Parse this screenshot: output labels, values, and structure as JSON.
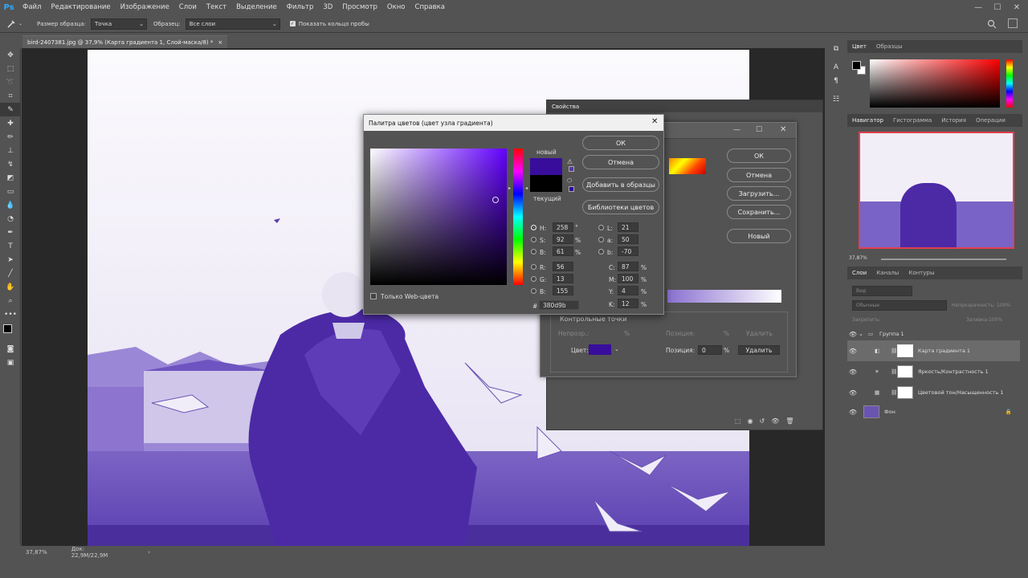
{
  "app": {
    "logo": "Ps",
    "menu": [
      "Файл",
      "Редактирование",
      "Изображение",
      "Слои",
      "Текст",
      "Выделение",
      "Фильтр",
      "3D",
      "Просмотр",
      "Окно",
      "Справка"
    ]
  },
  "window": {
    "minimize": "—",
    "maximize": "☐",
    "close": "✕"
  },
  "options": {
    "sample_size_label": "Размер образца:",
    "sample_size_value": "Точка",
    "sample_label": "Образец:",
    "sample_value": "Все слои",
    "show_ring_label": "Показать кольцо пробы"
  },
  "document": {
    "tab_title": "bird-2407381.jpg @ 37,9% (Карта градиента 1, Слой-маска/8) *",
    "tab_close": "×",
    "zoom": "37,87%",
    "doc_size": "Док: 22,9M/22,9M"
  },
  "color_panel": {
    "tabs": [
      "Цвет",
      "Образцы"
    ]
  },
  "navigator": {
    "tabs": [
      "Навигатор",
      "Гистограмма",
      "История",
      "Операции"
    ],
    "zoom": "37,87%"
  },
  "layers_panel": {
    "tabs": [
      "Слои",
      "Каналы",
      "Контуры"
    ],
    "kind_placeholder": "Вид",
    "blend_mode": "Обычные",
    "opacity_label": "Непрозрачность:",
    "opacity_value": "100%",
    "lock_label": "Закрепить:",
    "fill_label": "Заливка:",
    "fill_value": "100%",
    "layers": [
      {
        "name": "Группа 1"
      },
      {
        "name": "Карта градиента 1"
      },
      {
        "name": "Яркость/Контрастность 1"
      },
      {
        "name": "Цветовой тон/Насыщенность 1"
      },
      {
        "name": "Фон"
      }
    ]
  },
  "properties": {
    "title": "Свойства"
  },
  "gradient_editor": {
    "ok": "ОК",
    "cancel": "Отмена",
    "load": "Загрузить...",
    "save": "Сохранить...",
    "new": "Новый",
    "stops_label": "Контрольные точки",
    "opacity_label": "Непрозр.:",
    "position_label": "Позиция:",
    "position_value": "0",
    "percent": "%",
    "delete": "Удалить",
    "color_label": "Цвет:",
    "opacity_color": "#5a5a5a"
  },
  "color_picker": {
    "title": "Палитра цветов (цвет узла градиента)",
    "new_label": "новый",
    "current_label": "текущий",
    "ok": "ОК",
    "cancel": "Отмена",
    "add_swatch": "Добавить в образцы",
    "libraries": "Библиотеки цветов",
    "web_only": "Только Web-цвета",
    "fields": {
      "H": "258",
      "S": "92",
      "B": "61",
      "R": "56",
      "G": "13",
      "Bv": "155",
      "L": "21",
      "a": "50",
      "b": "-70",
      "C": "87",
      "M": "100",
      "Y": "4",
      "K": "12"
    },
    "units": {
      "deg": "°",
      "pct": "%"
    },
    "hex_label": "#",
    "hex": "380d9b",
    "new_color": "#380d9b",
    "current_color": "#000000"
  },
  "colors": {
    "accent": "#31a8ff",
    "purple": "#5a2fc8",
    "nav_border": "#e04050"
  }
}
